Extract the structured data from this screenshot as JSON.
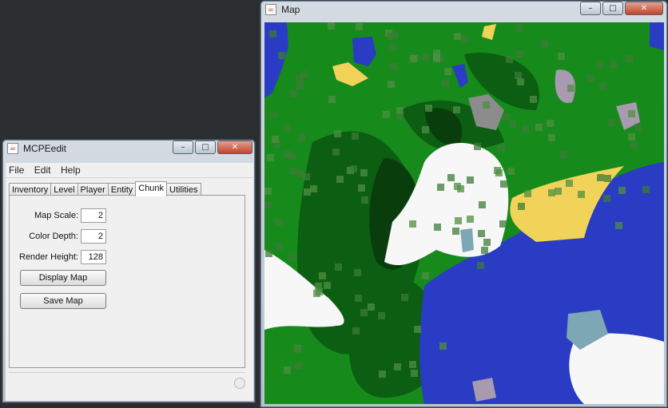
{
  "editor": {
    "title": "MCPEedit",
    "icon": "java-cup-icon",
    "controls": {
      "minimize": "–",
      "maximize": "□",
      "close": "✕"
    },
    "menu": [
      "File",
      "Edit",
      "Help"
    ],
    "tabs": [
      "Inventory",
      "Level",
      "Player",
      "Entity",
      "Chunk",
      "Utilities"
    ],
    "active_tab": "Chunk",
    "fields": {
      "map_scale": {
        "label": "Map Scale:",
        "value": "2"
      },
      "color_depth": {
        "label": "Color Depth:",
        "value": "2"
      },
      "render_height": {
        "label": "Render Height:",
        "value": "128"
      }
    },
    "buttons": {
      "display_map": "Display Map",
      "save_map": "Save Map"
    }
  },
  "map_window": {
    "title": "Map",
    "icon": "java-cup-icon",
    "controls": {
      "minimize": "–",
      "maximize": "□",
      "close": "✕"
    },
    "palette": {
      "grass": "#178a1c",
      "forest": "#0b5e12",
      "dark_forest": "#0a3d0c",
      "water": "#2a3bc4",
      "snow": "#f7f7f7",
      "sand": "#f2d35a",
      "stone": "#8c8c8c",
      "clay": "#a89ab0",
      "ice": "#7da7b5"
    }
  }
}
